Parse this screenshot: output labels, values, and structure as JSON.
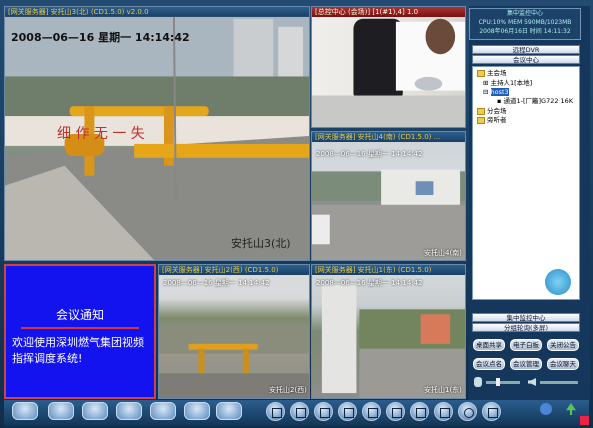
{
  "panes": {
    "p1": {
      "title": "[网关服务器] 安托山3(北) (CD1.5.0) v2.0.0",
      "date": "2008—06—16",
      "weekday": "星期一",
      "time": "14:14:42",
      "caption": "安托山3(北)",
      "wall_text": "细  作    无  一  失"
    },
    "p2": {
      "title": "[总控中心 (会场)] [1(#1),4] 1.0",
      "date": "",
      "time": ""
    },
    "p3": {
      "title": "[网关服务器] 安托山4(南) (CD1.5.0) ...",
      "date": "2008—06—16",
      "weekday": "星期一",
      "time": "14:14:42",
      "caption": "安托山4(南)"
    },
    "p4": {
      "title": "[网关服务器] 安托山2(西) (CD1.5.0)",
      "date": "2008—06—16",
      "weekday": "星期一",
      "time": "14:14:42",
      "caption": "安托山2(西)"
    },
    "p5": {
      "title": "[网关服务器] 安托山1(东) (CD1.5.0)",
      "date": "2008—06—16",
      "weekday": "星期一",
      "time": "14:14:42",
      "caption": "安托山1(东)"
    }
  },
  "notice": {
    "title": "会议通知",
    "body": "欢迎使用深圳燃气集团视频指挥调度系统!"
  },
  "status": {
    "line1": "集中监控中心",
    "line2": "CPU:10% MEM 590MB/1023MB",
    "line3": "2008年06月16日 时间 14:11:32"
  },
  "right": {
    "tab_remote": "远程DVR",
    "tab_meeting": "会议中心",
    "tree": {
      "main_venue": "主会场",
      "host1": "主持人1[本地]",
      "host3": "host3",
      "channel": "通道1-[厂籬]G722 16K",
      "sub_venue": "分会场",
      "listener": "旁听者"
    },
    "tab_center": "集中监控中心",
    "tab_group": "分组轮询(多屏)",
    "buttons": [
      "桌面共享",
      "电子白板",
      "关闭公告",
      "会议点名",
      "会议管理",
      "会议聊天"
    ]
  }
}
